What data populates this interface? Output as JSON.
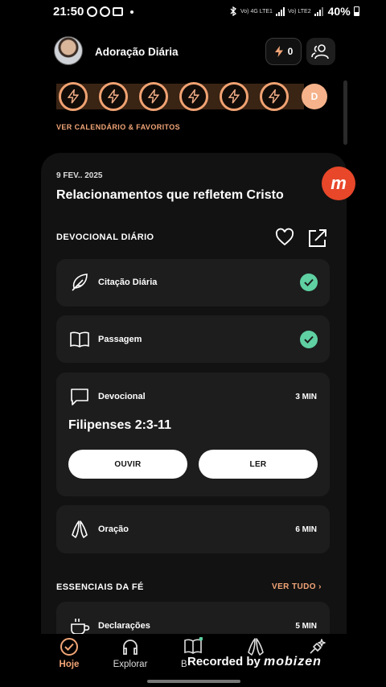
{
  "status_bar": {
    "time": "21:50",
    "battery": "40%",
    "network_1": "Vo) 4G LTE1",
    "network_2": "Vo) LTE2"
  },
  "header": {
    "title": "Adoração Diária",
    "streak_count": "0"
  },
  "streak": {
    "day_letter": "D",
    "calendar_link": "VER CALENDÁRIO & FAVORITOS"
  },
  "devotional": {
    "date": "9 FEV.. 2025",
    "title": "Relacionamentos que refletem Cristo",
    "section_label": "DEVOCIONAL DIÁRIO"
  },
  "cards": {
    "quote": {
      "label": "Citação Diária"
    },
    "passage": {
      "label": "Passagem"
    },
    "devotional": {
      "label": "Devocional",
      "duration": "3 MIN",
      "reference": "Filipenses 2:3-11",
      "listen_label": "OUVIR",
      "read_label": "LER"
    },
    "prayer": {
      "label": "Oração",
      "duration": "6 MIN"
    }
  },
  "essentials": {
    "title": "ESSENCIAIS DA FÉ",
    "see_all": "VER TUDO",
    "first_item": {
      "label": "Declarações",
      "duration": "5 MIN"
    }
  },
  "nav": {
    "home": "Hoje",
    "explore": "Explorar",
    "bible": "B",
    "prayer": "",
    "more": ""
  },
  "watermark": {
    "text": "Recorded by",
    "brand": "mobizen"
  },
  "colors": {
    "accent": "#f2a577",
    "check": "#5fd0a2",
    "card": "#1d1d1d",
    "sheet": "#121212"
  }
}
